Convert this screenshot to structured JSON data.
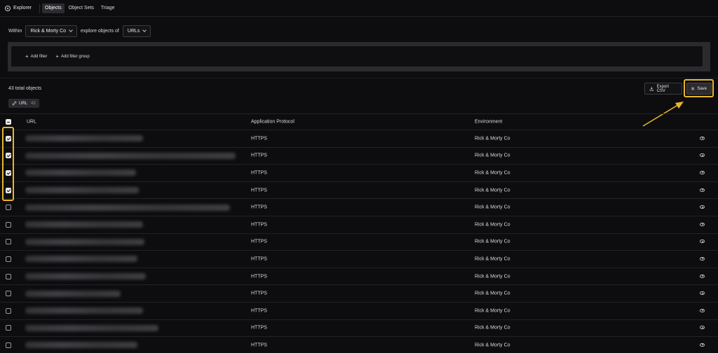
{
  "nav": {
    "brand": "Explorer",
    "tabs": [
      "Objects",
      "Object Sets",
      "Triage"
    ],
    "active_tab": "Objects"
  },
  "query": {
    "within_label": "Within",
    "within_value": "Rick & Morty Co",
    "explore_label": "explore objects of",
    "object_type": "URLs"
  },
  "filters": {
    "add_filter": "Add filter",
    "add_filter_group": "Add filter group"
  },
  "results": {
    "total_label": "43 total objects",
    "tag_label": "URL",
    "tag_count": "43",
    "export_label": "Export CSV",
    "save_label": "Save"
  },
  "table": {
    "headers": [
      "URL",
      "Application Protocol",
      "Environment"
    ],
    "rows": [
      {
        "protocol": "HTTPS",
        "environment": "Rick & Morty Co",
        "checked": true
      },
      {
        "protocol": "HTTPS",
        "environment": "Rick & Morty Co",
        "checked": true
      },
      {
        "protocol": "HTTPS",
        "environment": "Rick & Morty Co",
        "checked": true
      },
      {
        "protocol": "HTTPS",
        "environment": "Rick & Morty Co",
        "checked": true
      },
      {
        "protocol": "HTTPS",
        "environment": "Rick & Morty Co",
        "checked": false
      },
      {
        "protocol": "HTTPS",
        "environment": "Rick & Morty Co",
        "checked": false
      },
      {
        "protocol": "HTTPS",
        "environment": "Rick & Morty Co",
        "checked": false
      },
      {
        "protocol": "HTTPS",
        "environment": "Rick & Morty Co",
        "checked": false
      },
      {
        "protocol": "HTTPS",
        "environment": "Rick & Morty Co",
        "checked": false
      },
      {
        "protocol": "HTTPS",
        "environment": "Rick & Morty Co",
        "checked": false
      },
      {
        "protocol": "HTTPS",
        "environment": "Rick & Morty Co",
        "checked": false
      },
      {
        "protocol": "HTTPS",
        "environment": "Rick & Morty Co",
        "checked": false
      },
      {
        "protocol": "HTTPS",
        "environment": "Rick & Morty Co",
        "checked": false
      }
    ]
  },
  "colors": {
    "highlight": "#e8b52c",
    "background": "#0d0d0f"
  },
  "icons": {
    "brand": "compass-icon",
    "export": "download-icon",
    "save": "floppy-disk-icon",
    "tag": "link-icon",
    "row_action": "eye-icon"
  }
}
